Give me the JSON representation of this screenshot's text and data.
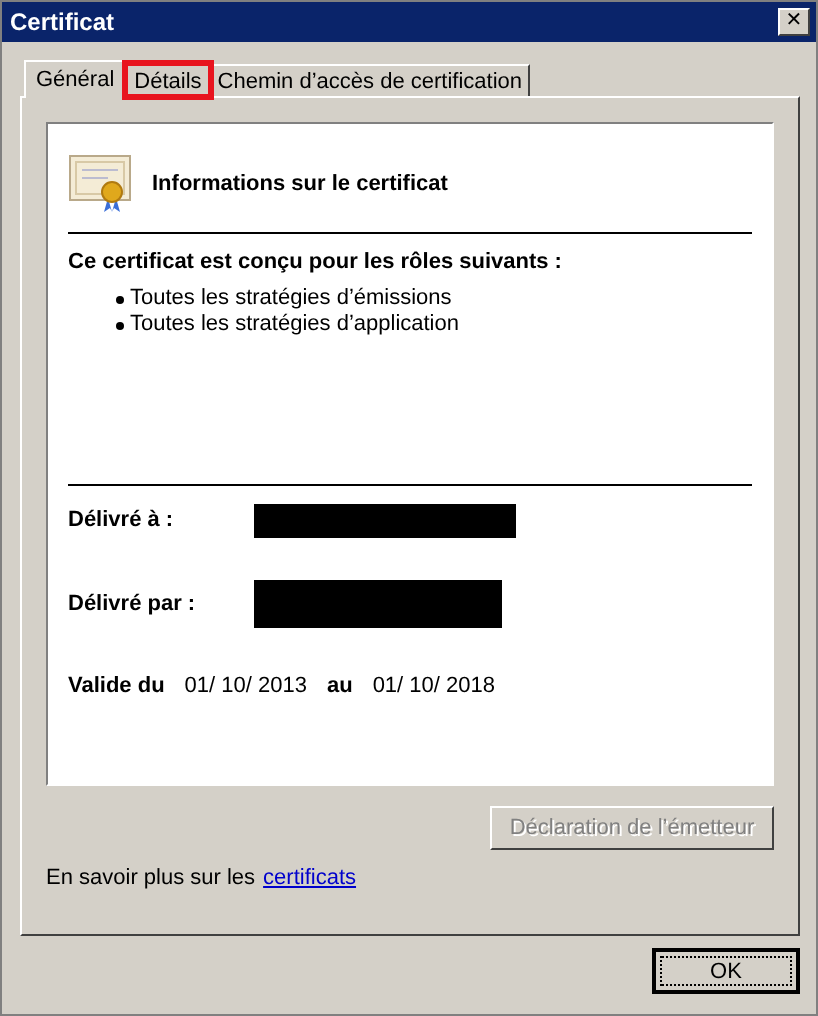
{
  "window": {
    "title": "Certificat",
    "close": "✕"
  },
  "tabs": [
    {
      "label": "Général",
      "selected": true,
      "highlighted": false
    },
    {
      "label": "Détails",
      "selected": false,
      "highlighted": true
    },
    {
      "label": "Chemin d’accès de certification",
      "selected": false,
      "highlighted": false
    }
  ],
  "info": {
    "heading": "Informations sur le certificat",
    "roles_title": "Ce certificat est conçu pour les rôles suivants :",
    "roles": [
      "Toutes les stratégies d’émissions",
      "Toutes les stratégies d’application"
    ],
    "issued_to": {
      "label": "Délivré à :",
      "redacted": true
    },
    "issued_by": {
      "label": "Délivré par :",
      "redacted": true
    },
    "validity": {
      "from_label": "Valide du",
      "from": "01/ 10/ 2013",
      "to_label": "au",
      "to": "01/ 10/ 2018"
    }
  },
  "issuer_button": {
    "label": "Déclaration de l’émetteur",
    "disabled": true
  },
  "learn_more": {
    "text": "En savoir plus sur les",
    "link": "certificats"
  },
  "buttons": [
    {
      "label": "OK",
      "focused": true
    }
  ]
}
